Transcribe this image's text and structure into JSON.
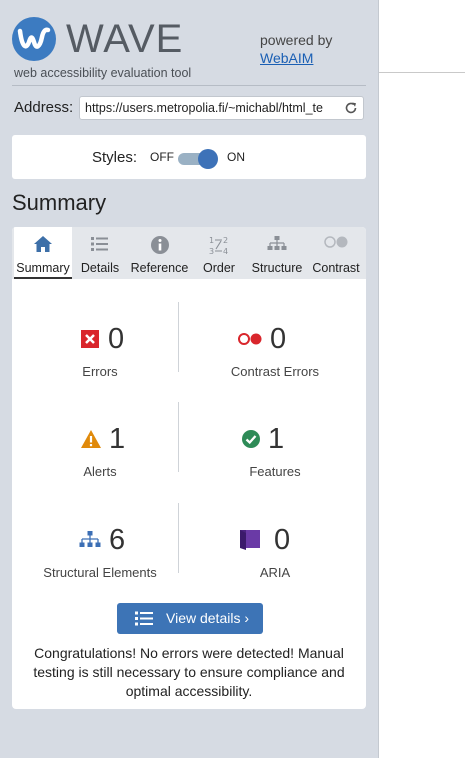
{
  "brand": {
    "title": "WAVE",
    "tagline": "web accessibility evaluation tool",
    "powered_by": "powered by",
    "webaim_link": "WebAIM"
  },
  "address": {
    "label": "Address:",
    "value": "https://users.metropolia.fi/~michabl/html_te"
  },
  "styles": {
    "label": "Styles:",
    "off": "OFF",
    "on": "ON",
    "state": "on"
  },
  "summary_heading": "Summary",
  "tabs": [
    {
      "label": "Summary",
      "icon": "home-icon",
      "active": true
    },
    {
      "label": "Details",
      "icon": "list-icon",
      "active": false
    },
    {
      "label": "Reference",
      "icon": "info-icon",
      "active": false
    },
    {
      "label": "Order",
      "icon": "order-icon",
      "active": false
    },
    {
      "label": "Structure",
      "icon": "structure-icon",
      "active": false
    },
    {
      "label": "Contrast",
      "icon": "contrast-icon",
      "active": false
    }
  ],
  "stats": {
    "errors": {
      "count": "0",
      "label": "Errors",
      "icon": "error-icon",
      "color": "#d9262c"
    },
    "contrast_errors": {
      "count": "0",
      "label": "Contrast Errors",
      "icon": "contrast-error-icon",
      "color": "#d9262c"
    },
    "alerts": {
      "count": "1",
      "label": "Alerts",
      "icon": "alert-icon",
      "color": "#e08a0b"
    },
    "features": {
      "count": "1",
      "label": "Features",
      "icon": "feature-check-icon",
      "color": "#2e8b57"
    },
    "structural": {
      "count": "6",
      "label": "Structural Elements",
      "icon": "structure-icon",
      "color": "#3c6fb5"
    },
    "aria": {
      "count": "0",
      "label": "ARIA",
      "icon": "aria-icon",
      "color": "#5b2d91"
    }
  },
  "view_details": "View details ›",
  "congrats": "Congratulations! No errors were detected! Manual testing is still necessary to ensure compliance and optimal accessibility.",
  "colors": {
    "sidebar_bg": "#d6dbe3",
    "accent": "#3d74b6"
  }
}
